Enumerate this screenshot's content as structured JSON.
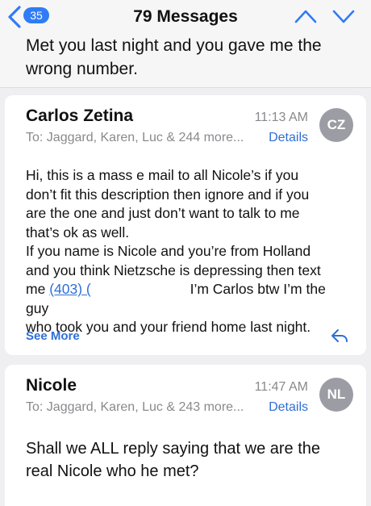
{
  "header": {
    "unread_badge": "35",
    "title": "79 Messages"
  },
  "thread": {
    "subject_line1": "Met you last night and you gave me the",
    "subject_line2": "wrong number."
  },
  "messages": [
    {
      "sender": "Carlos Zetina",
      "time": "11:13 AM",
      "avatar_initials": "CZ",
      "to_line": "To: Jaggard, Karen, Luc & 244 more...",
      "details_label": "Details",
      "body": [
        "Hi, this is a mass e mail to all Nicole’s if you",
        "don’t fit this description then ignore and if you",
        "are the one and just don’t want to talk to me",
        "that’s ok as well.",
        "If you name is Nicole and you’re from Holland",
        "and you think Nietzsche is depressing then text"
      ],
      "phone_prefix": "me ",
      "phone": "(403) (",
      "phone_suffix": " I’m Carlos btw I’m the guy",
      "body_last": "who took you and your friend home last night.",
      "see_more_label": "See More"
    },
    {
      "sender": "Nicole",
      "time": "11:47 AM",
      "avatar_initials": "NL",
      "to_line": "To: Jaggard, Karen, Luc & 243 more...",
      "details_label": "Details",
      "body": [
        "Shall we ALL reply saying that we are the",
        "real Nicole who he met?"
      ]
    }
  ],
  "colors": {
    "accent": "#2f7cf6",
    "link": "#2f6fd6",
    "avatar": "#9c9ca4",
    "secondary_text": "#8a8a8e",
    "background": "#efeff1"
  },
  "icons": {
    "back": "chevron-left-icon",
    "previous": "chevron-up-icon",
    "next": "chevron-down-icon",
    "reply": "reply-icon"
  }
}
